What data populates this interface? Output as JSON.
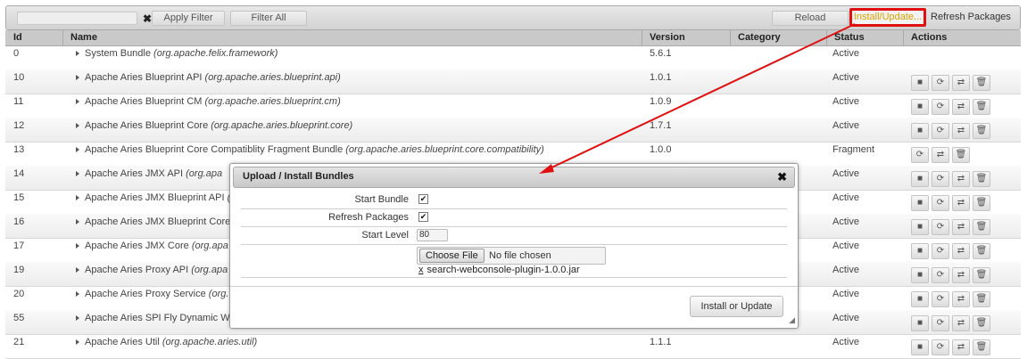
{
  "toolbar": {
    "filter_placeholder": "",
    "clear_label": "✖",
    "apply_filter": "Apply Filter",
    "filter_all": "Filter All",
    "reload": "Reload",
    "install_update": "Install/Update...",
    "refresh_packages": "Refresh Packages"
  },
  "columns": [
    "Id",
    "Name",
    "Version",
    "Category",
    "Status",
    "Actions"
  ],
  "rows": [
    {
      "id": "0",
      "name": "System Bundle",
      "symbolic": "(org.apache.felix.framework)",
      "version": "5.6.1",
      "category": "",
      "status": "Active",
      "actions": []
    },
    {
      "id": "10",
      "name": "Apache Aries Blueprint API",
      "symbolic": "(org.apache.aries.blueprint.api)",
      "version": "1.0.1",
      "category": "",
      "status": "Active",
      "actions": [
        "stop",
        "refresh",
        "update",
        "uninstall"
      ]
    },
    {
      "id": "11",
      "name": "Apache Aries Blueprint CM",
      "symbolic": "(org.apache.aries.blueprint.cm)",
      "version": "1.0.9",
      "category": "",
      "status": "Active",
      "actions": [
        "stop",
        "refresh",
        "update",
        "uninstall"
      ]
    },
    {
      "id": "12",
      "name": "Apache Aries Blueprint Core",
      "symbolic": "(org.apache.aries.blueprint.core)",
      "version": "1.7.1",
      "category": "",
      "status": "Active",
      "actions": [
        "stop",
        "refresh",
        "update",
        "uninstall"
      ]
    },
    {
      "id": "13",
      "name": "Apache Aries Blueprint Core Compatiblity Fragment Bundle",
      "symbolic": "(org.apache.aries.blueprint.core.compatibility)",
      "version": "1.0.0",
      "category": "",
      "status": "Fragment",
      "actions": [
        "refresh",
        "update",
        "uninstall"
      ]
    },
    {
      "id": "14",
      "name": "Apache Aries JMX API",
      "symbolic": "(org.apa",
      "version": "",
      "category": "",
      "status": "Active",
      "actions": [
        "stop",
        "refresh",
        "update",
        "uninstall"
      ]
    },
    {
      "id": "15",
      "name": "Apache Aries JMX Blueprint API",
      "symbolic": "(",
      "version": "",
      "category": "",
      "status": "Active",
      "actions": [
        "stop",
        "refresh",
        "update",
        "uninstall"
      ]
    },
    {
      "id": "16",
      "name": "Apache Aries JMX Blueprint Core",
      "symbolic": "",
      "version": "",
      "category": "",
      "status": "Active",
      "actions": [
        "stop",
        "refresh",
        "update",
        "uninstall"
      ]
    },
    {
      "id": "17",
      "name": "Apache Aries JMX Core",
      "symbolic": "(org.apa",
      "version": "",
      "category": "",
      "status": "Active",
      "actions": [
        "stop",
        "refresh",
        "update",
        "uninstall"
      ]
    },
    {
      "id": "19",
      "name": "Apache Aries Proxy API",
      "symbolic": "(org.apa",
      "version": "",
      "category": "",
      "status": "Active",
      "actions": [
        "stop",
        "refresh",
        "update",
        "uninstall"
      ]
    },
    {
      "id": "20",
      "name": "Apache Aries Proxy Service",
      "symbolic": "(org.",
      "version": "",
      "category": "",
      "status": "Active",
      "actions": [
        "stop",
        "refresh",
        "update",
        "uninstall"
      ]
    },
    {
      "id": "55",
      "name": "Apache Aries SPI Fly Dynamic W",
      "symbolic": "",
      "version": "",
      "category": "",
      "status": "Active",
      "actions": [
        "stop",
        "refresh",
        "update",
        "uninstall"
      ]
    },
    {
      "id": "21",
      "name": "Apache Aries Util",
      "symbolic": "(org.apache.aries.util)",
      "version": "1.1.1",
      "category": "",
      "status": "Active",
      "actions": [
        "stop",
        "refresh",
        "update",
        "uninstall"
      ]
    }
  ],
  "dialog": {
    "title": "Upload / Install Bundles",
    "close": "✖",
    "start_bundle_label": "Start Bundle",
    "start_bundle_checked": "✔",
    "refresh_packages_label": "Refresh Packages",
    "refresh_packages_checked": "✔",
    "start_level_label": "Start Level",
    "start_level_value": "80",
    "choose_file": "Choose File",
    "no_file": "No file chosen",
    "remove_file": "x",
    "file_name": "search-webconsole-plugin-1.0.0.jar",
    "install_button": "Install or Update"
  },
  "colors": {
    "highlight": "#e01010",
    "arrow": "#e01010"
  }
}
